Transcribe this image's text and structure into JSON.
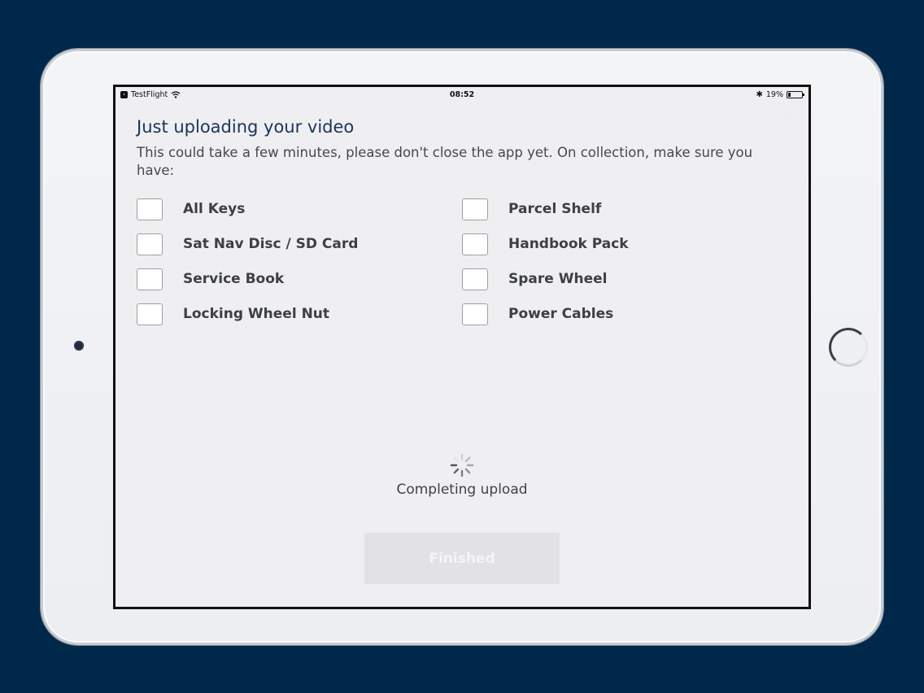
{
  "status_bar": {
    "back_app": "TestFlight",
    "time": "08:52",
    "battery_percent": "19%",
    "battery_level": 0.19
  },
  "upload": {
    "title": "Just uploading your video",
    "instructions": "This could take a few minutes, please don't close the app yet. On collection, make sure you have:",
    "status_text": "Completing upload",
    "finished_label": "Finished"
  },
  "checklist": {
    "left": [
      {
        "label": "All Keys",
        "checked": false
      },
      {
        "label": "Sat Nav Disc / SD Card",
        "checked": false
      },
      {
        "label": "Service Book",
        "checked": false
      },
      {
        "label": "Locking Wheel Nut",
        "checked": false
      }
    ],
    "right": [
      {
        "label": "Parcel Shelf",
        "checked": false
      },
      {
        "label": "Handbook Pack",
        "checked": false
      },
      {
        "label": "Spare Wheel",
        "checked": false
      },
      {
        "label": "Power Cables",
        "checked": false
      }
    ]
  },
  "colors": {
    "background": "#00284a",
    "title": "#1a3560",
    "button_disabled": "#e2e2e5"
  },
  "icons": [
    "back-chevron-icon",
    "wifi-icon",
    "bluetooth-icon",
    "battery-icon",
    "loading-spinner-icon"
  ]
}
